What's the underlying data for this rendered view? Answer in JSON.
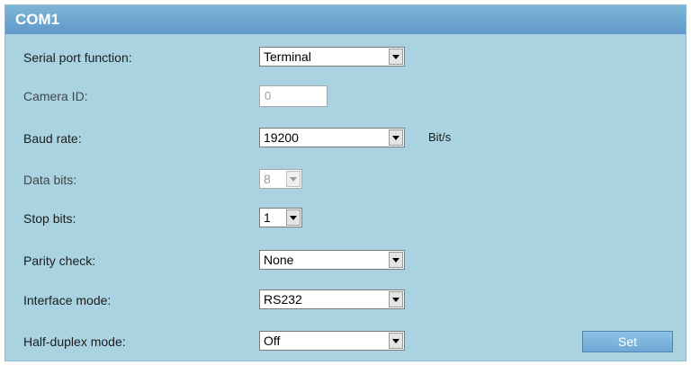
{
  "panel": {
    "title": "COM1"
  },
  "fields": {
    "serial_port_function": {
      "label": "Serial port function:",
      "value": "Terminal"
    },
    "camera_id": {
      "label": "Camera ID:",
      "value": "0"
    },
    "baud_rate": {
      "label": "Baud rate:",
      "value": "19200",
      "unit": "Bit/s"
    },
    "data_bits": {
      "label": "Data bits:",
      "value": "8"
    },
    "stop_bits": {
      "label": "Stop bits:",
      "value": "1"
    },
    "parity_check": {
      "label": "Parity check:",
      "value": "None"
    },
    "interface_mode": {
      "label": "Interface mode:",
      "value": "RS232"
    },
    "half_duplex_mode": {
      "label": "Half-duplex mode:",
      "value": "Off"
    }
  },
  "actions": {
    "set_label": "Set"
  },
  "icons": {
    "dropdown_arrow": "chevron-down-icon"
  },
  "colors": {
    "panel_background": "#aad3e1",
    "title_bar": "#6ca4d0",
    "button": "#7db4df"
  }
}
